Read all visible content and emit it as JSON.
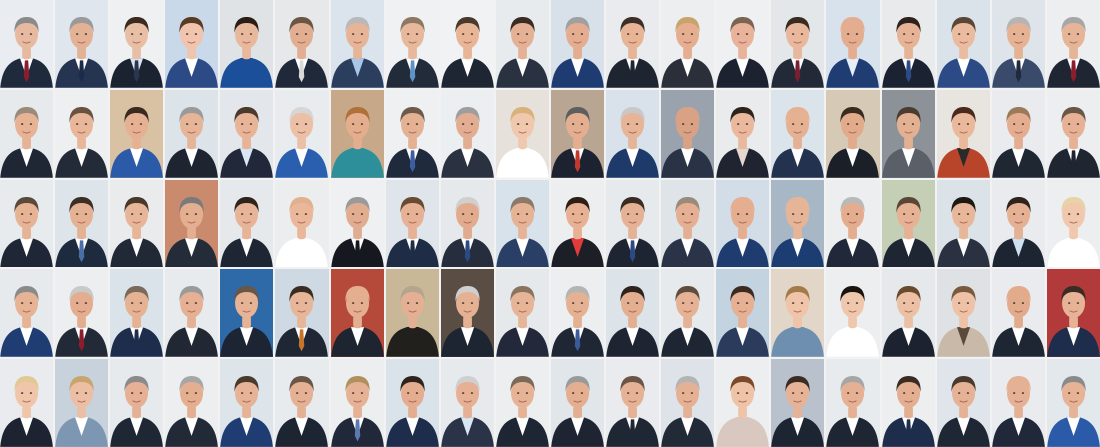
{
  "mosaic": {
    "rows": 5,
    "columns": 20,
    "tiles": [
      {
        "bg": "#e9edf2",
        "skin": "#e7b9a0",
        "hair": "#8a8a8a",
        "suit": "#1f2a3d",
        "shirt": "#ffffff",
        "tie": "#8b1d2c"
      },
      {
        "bg": "#dfe6ee",
        "skin": "#e3b295",
        "hair": "#9a9a9a",
        "suit": "#243451",
        "shirt": "#ffffff",
        "tie": "#1d2b4a"
      },
      {
        "bg": "#eef0f2",
        "skin": "#e8bfa5",
        "hair": "#3b2a1e",
        "suit": "#1b2230",
        "shirt": "#dbe6f1",
        "tie": "#2b3550"
      },
      {
        "bg": "#c9d9ea",
        "skin": "#f0c4ad",
        "hair": "#5a3b26",
        "suit": "#2b4a86",
        "shirt": "#ffffff",
        "tie": null
      },
      {
        "bg": "#dfe3e6",
        "skin": "#e8b89c",
        "hair": "#2b1d15",
        "suit": "#1c4f99",
        "shirt": "#1c4f99",
        "tie": null
      },
      {
        "bg": "#e6e8ea",
        "skin": "#e2ae92",
        "hair": "#6b5545",
        "suit": "#20293a",
        "shirt": "#ffffff",
        "tie": "#d9d9d9"
      },
      {
        "bg": "#dbe4ec",
        "skin": "#e6b497",
        "hair": "#b9b9b9",
        "suit": "#2b3e5e",
        "shirt": "#a8c6e8",
        "tie": null
      },
      {
        "bg": "#eff1f3",
        "skin": "#e7b89b",
        "hair": "#8e7864",
        "suit": "#222b3a",
        "shirt": "#ffffff",
        "tie": "#5f93c8"
      },
      {
        "bg": "#f1f2f3",
        "skin": "#e9b597",
        "hair": "#4a3a2e",
        "suit": "#1f2633",
        "shirt": "#ffffff",
        "tie": null
      },
      {
        "bg": "#e7ebee",
        "skin": "#e4b194",
        "hair": "#3a2c22",
        "suit": "#2a3140",
        "shirt": "#ffffff",
        "tie": null
      },
      {
        "bg": "#d8e1ea",
        "skin": "#e5ad8f",
        "hair": "#a0a0a0",
        "suit": "#1e3c72",
        "shirt": "#ffffff",
        "tie": null
      },
      {
        "bg": "#e9ebee",
        "skin": "#e7b596",
        "hair": "#3b2f28",
        "suit": "#1f2530",
        "shirt": "#ffffff",
        "tie": "#1f2530"
      },
      {
        "bg": "#eceef0",
        "skin": "#e6ae90",
        "hair": "#c9a46a",
        "suit": "#2a2f3a",
        "shirt": "#ffffff",
        "tie": null
      },
      {
        "bg": "#eef0f2",
        "skin": "#e8b39a",
        "hair": "#7a6552",
        "suit": "#1c2230",
        "shirt": "#ffffff",
        "tie": null
      },
      {
        "bg": "#e4e7ea",
        "skin": "#e9b89c",
        "hair": "#3a2b21",
        "suit": "#222a38",
        "shirt": "#ffffff",
        "tie": "#7a1f30"
      },
      {
        "bg": "#d7e2ec",
        "skin": "#e4ad90",
        "hair": "#e4ad90",
        "suit": "#1f3d73",
        "shirt": "#e6eef7",
        "tie": null
      },
      {
        "bg": "#e8eaec",
        "skin": "#e6b397",
        "hair": "#2d231c",
        "suit": "#1b2231",
        "shirt": "#ffffff",
        "tie": "#2b4a86"
      },
      {
        "bg": "#dbe3ea",
        "skin": "#ebbb9f",
        "hair": "#5a4636",
        "suit": "#2b4a86",
        "shirt": "#ffffff",
        "tie": null
      },
      {
        "bg": "#dfe4ea",
        "skin": "#e5b293",
        "hair": "#b5b5b5",
        "suit": "#3a4a6b",
        "shirt": "#ffffff",
        "tie": "#1f2a3d"
      },
      {
        "bg": "#eceef0",
        "skin": "#e6b497",
        "hair": "#a6a6a6",
        "suit": "#1f2533",
        "shirt": "#ffffff",
        "tie": "#8b1d2c"
      },
      {
        "bg": "#e7eaed",
        "skin": "#e6b395",
        "hair": "#9a8a7a",
        "suit": "#1f2735",
        "shirt": "#ffffff",
        "tie": null
      },
      {
        "bg": "#eeeff1",
        "skin": "#e8b698",
        "hair": "#6a5242",
        "suit": "#242b38",
        "shirt": "#ffffff",
        "tie": null
      },
      {
        "bg": "#d9c2a3",
        "skin": "#e6b193",
        "hair": "#3a2b20",
        "suit": "#2a5aa8",
        "shirt": "#ffffff",
        "tie": null
      },
      {
        "bg": "#dce3e9",
        "skin": "#e6b497",
        "hair": "#9a9a9a",
        "suit": "#1e2430",
        "shirt": "#ffffff",
        "tie": null
      },
      {
        "bg": "#e3e7eb",
        "skin": "#e7b497",
        "hair": "#4a3a2c",
        "suit": "#20283a",
        "shirt": "#d9e6f3",
        "tie": null
      },
      {
        "bg": "#e9ecef",
        "skin": "#ecc0a6",
        "hair": "#d6d6d6",
        "suit": "#2a5fb0",
        "shirt": "#ffffff",
        "tie": null
      },
      {
        "bg": "#c7a98a",
        "skin": "#e3ad8e",
        "hair": "#b0703a",
        "suit": "#2d8f9a",
        "shirt": "#2d8f9a",
        "tie": null
      },
      {
        "bg": "#eef0f2",
        "skin": "#e5b193",
        "hair": "#6e5a4a",
        "suit": "#1f2a3d",
        "shirt": "#ffffff",
        "tie": "#3a5ea0"
      },
      {
        "bg": "#eceff1",
        "skin": "#e2ad90",
        "hair": "#9e9e9e",
        "suit": "#2a3140",
        "shirt": "#ffffff",
        "tie": null
      },
      {
        "bg": "#e6e1da",
        "skin": "#f0c8ae",
        "hair": "#d8b27a",
        "suit": "#ffffff",
        "shirt": "#ffffff",
        "tie": null
      },
      {
        "bg": "#b8a692",
        "skin": "#e4ae90",
        "hair": "#5e5e5e",
        "suit": "#1d2230",
        "shirt": "#ffffff",
        "tie": "#c0392b"
      },
      {
        "bg": "#d9e2ea",
        "skin": "#e6b496",
        "hair": "#c8c8c8",
        "suit": "#1e3a6b",
        "shirt": "#ffffff",
        "tie": null
      },
      {
        "bg": "#9aa3ad",
        "skin": "#d9a285",
        "hair": "#d9a285",
        "suit": "#2a3346",
        "shirt": "#ffffff",
        "tie": null
      },
      {
        "bg": "#e9ebed",
        "skin": "#eab99d",
        "hair": "#2e231c",
        "suit": "#1f2430",
        "shirt": "#e6d7cf",
        "tie": null
      },
      {
        "bg": "#dce4eb",
        "skin": "#e6b193",
        "hair": "#e6b193",
        "suit": "#23324f",
        "shirt": "#ffffff",
        "tie": null
      },
      {
        "bg": "#d6c9b5",
        "skin": "#e2ab8c",
        "hair": "#3a2b20",
        "suit": "#1b1f27",
        "shirt": "#ffffff",
        "tie": null
      },
      {
        "bg": "#8d9299",
        "skin": "#e4b092",
        "hair": "#4a3c30",
        "suit": "#5a5f68",
        "shirt": "#ffffff",
        "tie": null
      },
      {
        "bg": "#e8e4df",
        "skin": "#eab89b",
        "hair": "#4a2a1c",
        "suit": "#b8452a",
        "shirt": "#2a2a2a",
        "tie": null
      },
      {
        "bg": "#e9ebee",
        "skin": "#e4ad8f",
        "hair": "#9a7a5a",
        "suit": "#1f2733",
        "shirt": "#ffffff",
        "tie": null
      },
      {
        "bg": "#eceef0",
        "skin": "#e6b194",
        "hair": "#6a5646",
        "suit": "#1f2531",
        "shirt": "#ffffff",
        "tie": "#1f2531"
      },
      {
        "bg": "#e8ebee",
        "skin": "#e6b395",
        "hair": "#5a4a3c",
        "suit": "#1f2736",
        "shirt": "#ffffff",
        "tie": null
      },
      {
        "bg": "#dde4ea",
        "skin": "#e5b193",
        "hair": "#3b2e24",
        "suit": "#1e2a3e",
        "shirt": "#ffffff",
        "tie": "#4a6fa8"
      },
      {
        "bg": "#e9ebed",
        "skin": "#e7b598",
        "hair": "#4a382a",
        "suit": "#212836",
        "shirt": "#ffffff",
        "tie": null
      },
      {
        "bg": "#c98a6e",
        "skin": "#e4ae91",
        "hair": "#7a7a7a",
        "suit": "#242b39",
        "shirt": "#ffffff",
        "tie": null
      },
      {
        "bg": "#e6e9ec",
        "skin": "#e7b497",
        "hair": "#2f241c",
        "suit": "#1e2533",
        "shirt": "#ffffff",
        "tie": null
      },
      {
        "bg": "#ecedef",
        "skin": "#eab79a",
        "hair": "#e0b08f",
        "suit": "#ffffff",
        "shirt": "#ffffff",
        "tie": null
      },
      {
        "bg": "#eef0f2",
        "skin": "#e1ad91",
        "hair": "#9a9a9a",
        "suit": "#15181f",
        "shirt": "#ffffff",
        "tie": "#15181f"
      },
      {
        "bg": "#dfe5ea",
        "skin": "#e6b194",
        "hair": "#6a4a30",
        "suit": "#1f2c46",
        "shirt": "#ffffff",
        "tie": "#1f2c46"
      },
      {
        "bg": "#e6e9ec",
        "skin": "#e2ab8d",
        "hair": "#cfcfcf",
        "suit": "#262e3d",
        "shirt": "#ffffff",
        "tie": "#2a4a86"
      },
      {
        "bg": "#d8e2eb",
        "skin": "#e6b396",
        "hair": "#8a7a6a",
        "suit": "#2a3f66",
        "shirt": "#ffffff",
        "tie": null
      },
      {
        "bg": "#eceef0",
        "skin": "#e8b194",
        "hair": "#2e1e15",
        "suit": "#1c1f26",
        "shirt": "#e23b3b",
        "tie": null
      },
      {
        "bg": "#e7eaed",
        "skin": "#e5b295",
        "hair": "#3a2c22",
        "suit": "#1e2431",
        "shirt": "#ffffff",
        "tie": "#2a4a86"
      },
      {
        "bg": "#dfe4e9",
        "skin": "#e4af92",
        "hair": "#9a8a7a",
        "suit": "#2a3347",
        "shirt": "#ffffff",
        "tie": null
      },
      {
        "bg": "#d3dde7",
        "skin": "#e5ae90",
        "hair": "#e5ae90",
        "suit": "#1f3c70",
        "shirt": "#ffffff",
        "tie": null
      },
      {
        "bg": "#a7b7c6",
        "skin": "#e6b597",
        "hair": "#e6b597",
        "suit": "#1c3d72",
        "shirt": "#ffffff",
        "tie": null
      },
      {
        "bg": "#eceef0",
        "skin": "#e4ad8f",
        "hair": "#b9b9b9",
        "suit": "#20283a",
        "shirt": "#ffffff",
        "tie": null
      },
      {
        "bg": "#c4cfb6",
        "skin": "#e6b194",
        "hair": "#5a4636",
        "suit": "#1f2633",
        "shirt": "#ffffff",
        "tie": null
      },
      {
        "bg": "#dbe2e8",
        "skin": "#e8b699",
        "hair": "#1e1813",
        "suit": "#2a3140",
        "shirt": "#ffffff",
        "tie": null
      },
      {
        "bg": "#e9ebee",
        "skin": "#e5b194",
        "hair": "#2e241d",
        "suit": "#1e2532",
        "shirt": "#cfe0f1",
        "tie": null
      },
      {
        "bg": "#eceef0",
        "skin": "#f0c8ad",
        "hair": "#e6d3a8",
        "suit": "#ffffff",
        "shirt": "#ffffff",
        "tie": null
      },
      {
        "bg": "#e7eaed",
        "skin": "#e6b395",
        "hair": "#8a8a8a",
        "suit": "#1f3d73",
        "shirt": "#ffffff",
        "tie": null
      },
      {
        "bg": "#eceef0",
        "skin": "#e4ad8f",
        "hair": "#c9c9c9",
        "suit": "#232a37",
        "shirt": "#ffffff",
        "tie": "#8b1d2c"
      },
      {
        "bg": "#dbe3ea",
        "skin": "#e6b294",
        "hair": "#7a6a5a",
        "suit": "#1e2d4c",
        "shirt": "#ffffff",
        "tie": "#1e2d4c"
      },
      {
        "bg": "#e8ebee",
        "skin": "#e5b093",
        "hair": "#9a9a9a",
        "suit": "#212733",
        "shirt": "#ffffff",
        "tie": null
      },
      {
        "bg": "#2f6aa8",
        "skin": "#e6b395",
        "hair": "#6a5646",
        "suit": "#1d2433",
        "shirt": "#ffffff",
        "tie": null
      },
      {
        "bg": "#cfd9e3",
        "skin": "#e7b598",
        "hair": "#3a2c22",
        "suit": "#1f2735",
        "shirt": "#ffffff",
        "tie": "#c8752a"
      },
      {
        "bg": "#b54a3a",
        "skin": "#e4ae91",
        "hair": "#e4ae91",
        "suit": "#1e2430",
        "shirt": "#ffffff",
        "tie": null
      },
      {
        "bg": "#c9b898",
        "skin": "#e4b094",
        "hair": "#b5a58e",
        "suit": "#22201c",
        "shirt": "#22201c",
        "tie": null
      },
      {
        "bg": "#5a4e44",
        "skin": "#e5b193",
        "hair": "#cfcfcf",
        "suit": "#1e2532",
        "shirt": "#ffffff",
        "tie": null
      },
      {
        "bg": "#e6e9ec",
        "skin": "#e6b497",
        "hair": "#8a7460",
        "suit": "#23293a",
        "shirt": "#ffffff",
        "tie": null
      },
      {
        "bg": "#eceef0",
        "skin": "#e5b193",
        "hair": "#b4b4b4",
        "suit": "#1f2735",
        "shirt": "#ffffff",
        "tie": "#3a5a9a"
      },
      {
        "bg": "#dce3e9",
        "skin": "#e4ae91",
        "hair": "#2e241d",
        "suit": "#1e2431",
        "shirt": "#ffffff",
        "tie": null
      },
      {
        "bg": "#e7eaed",
        "skin": "#e6b295",
        "hair": "#5e4e40",
        "suit": "#1f2633",
        "shirt": "#ffffff",
        "tie": null
      },
      {
        "bg": "#c4d3e0",
        "skin": "#e5b093",
        "hair": "#3a2c22",
        "suit": "#2a3b5c",
        "shirt": "#ffffff",
        "tie": null
      },
      {
        "bg": "#e2d6c9",
        "skin": "#efc4a8",
        "hair": "#a57a4a",
        "suit": "#6e8fb0",
        "shirt": "#6e8fb0",
        "tie": null
      },
      {
        "bg": "#eceef0",
        "skin": "#efc7ad",
        "hair": "#1a1410",
        "suit": "#ffffff",
        "shirt": "#ffffff",
        "tie": null
      },
      {
        "bg": "#e6e9ec",
        "skin": "#ecc0a5",
        "hair": "#6a4a2e",
        "suit": "#1d2230",
        "shirt": "#ffffff",
        "tie": null
      },
      {
        "bg": "#dfe2e5",
        "skin": "#eec2a6",
        "hair": "#7a5a3e",
        "suit": "#c8b9a8",
        "shirt": "#5a4a3c",
        "tie": null
      },
      {
        "bg": "#e9ebee",
        "skin": "#e2ab8c",
        "hair": "#e2ab8c",
        "suit": "#1e2533",
        "shirt": "#ffffff",
        "tie": null
      },
      {
        "bg": "#b23a3a",
        "skin": "#e6b396",
        "hair": "#3a2c22",
        "suit": "#1e2d4c",
        "shirt": "#ffffff",
        "tie": null
      },
      {
        "bg": "#e9ebee",
        "skin": "#f0c6ab",
        "hair": "#e1c995",
        "suit": "#1d2330",
        "shirt": "#ffffff",
        "tie": null
      },
      {
        "bg": "#c7d2dc",
        "skin": "#ecbfa4",
        "hair": "#c9a56e",
        "suit": "#7d97b3",
        "shirt": "#ffffff",
        "tie": null
      },
      {
        "bg": "#e7eaed",
        "skin": "#e5b093",
        "hair": "#8a8a8a",
        "suit": "#1f2735",
        "shirt": "#ffffff",
        "tie": null
      },
      {
        "bg": "#eceef0",
        "skin": "#e4ae91",
        "hair": "#a6a6a6",
        "suit": "#232a37",
        "shirt": "#ffffff",
        "tie": null
      },
      {
        "bg": "#dde4ea",
        "skin": "#e6b396",
        "hair": "#4a3a2e",
        "suit": "#1f3d73",
        "shirt": "#ffffff",
        "tie": null
      },
      {
        "bg": "#e8ebee",
        "skin": "#e5b194",
        "hair": "#6a5646",
        "suit": "#1e2532",
        "shirt": "#ffffff",
        "tie": null
      },
      {
        "bg": "#eceef0",
        "skin": "#e6b295",
        "hair": "#b0905e",
        "suit": "#20283a",
        "shirt": "#ffffff",
        "tie": "#5a7ab0"
      },
      {
        "bg": "#dbe3ea",
        "skin": "#e4ad8f",
        "hair": "#2e241d",
        "suit": "#1e2d4c",
        "shirt": "#ffffff",
        "tie": null
      },
      {
        "bg": "#e7eaed",
        "skin": "#e5b093",
        "hair": "#cfcfcf",
        "suit": "#2a3347",
        "shirt": "#d9e6f3",
        "tie": null
      },
      {
        "bg": "#eceef0",
        "skin": "#e6b396",
        "hair": "#7a6a5a",
        "suit": "#1f2633",
        "shirt": "#ffffff",
        "tie": null
      },
      {
        "bg": "#e1e6eb",
        "skin": "#e4ae91",
        "hair": "#9a9a9a",
        "suit": "#1e2431",
        "shirt": "#ffffff",
        "tie": null
      },
      {
        "bg": "#e9ebee",
        "skin": "#e6b295",
        "hair": "#6a5646",
        "suit": "#1f2735",
        "shirt": "#ffffff",
        "tie": "#1f2735"
      },
      {
        "bg": "#dde3e9",
        "skin": "#e5b194",
        "hair": "#b4b4b4",
        "suit": "#232a37",
        "shirt": "#ffffff",
        "tie": null
      },
      {
        "bg": "#eceef0",
        "skin": "#efc3a7",
        "hair": "#7a4a2a",
        "suit": "#d8c8c0",
        "shirt": "#d8c8c0",
        "tie": null
      },
      {
        "bg": "#b9c2cc",
        "skin": "#e6b396",
        "hair": "#3a2c22",
        "suit": "#1e2532",
        "shirt": "#ffffff",
        "tie": null
      },
      {
        "bg": "#e8ebee",
        "skin": "#e5b093",
        "hair": "#a6a6a6",
        "suit": "#1f2633",
        "shirt": "#ffffff",
        "tie": null
      },
      {
        "bg": "#eceef0",
        "skin": "#e4ae91",
        "hair": "#3a2c22",
        "suit": "#1e2d4c",
        "shirt": "#ffffff",
        "tie": "#1e2d4c"
      },
      {
        "bg": "#dfe5ea",
        "skin": "#e6b295",
        "hair": "#4a3a2e",
        "suit": "#1f2735",
        "shirt": "#ffffff",
        "tie": null
      },
      {
        "bg": "#e9ebee",
        "skin": "#e5b194",
        "hair": "#e5b194",
        "suit": "#20283a",
        "shirt": "#ffffff",
        "tie": null
      },
      {
        "bg": "#e3e8ed",
        "skin": "#e6b396",
        "hair": "#8a8a8a",
        "suit": "#2a5aa8",
        "shirt": "#ffffff",
        "tie": null
      }
    ]
  }
}
